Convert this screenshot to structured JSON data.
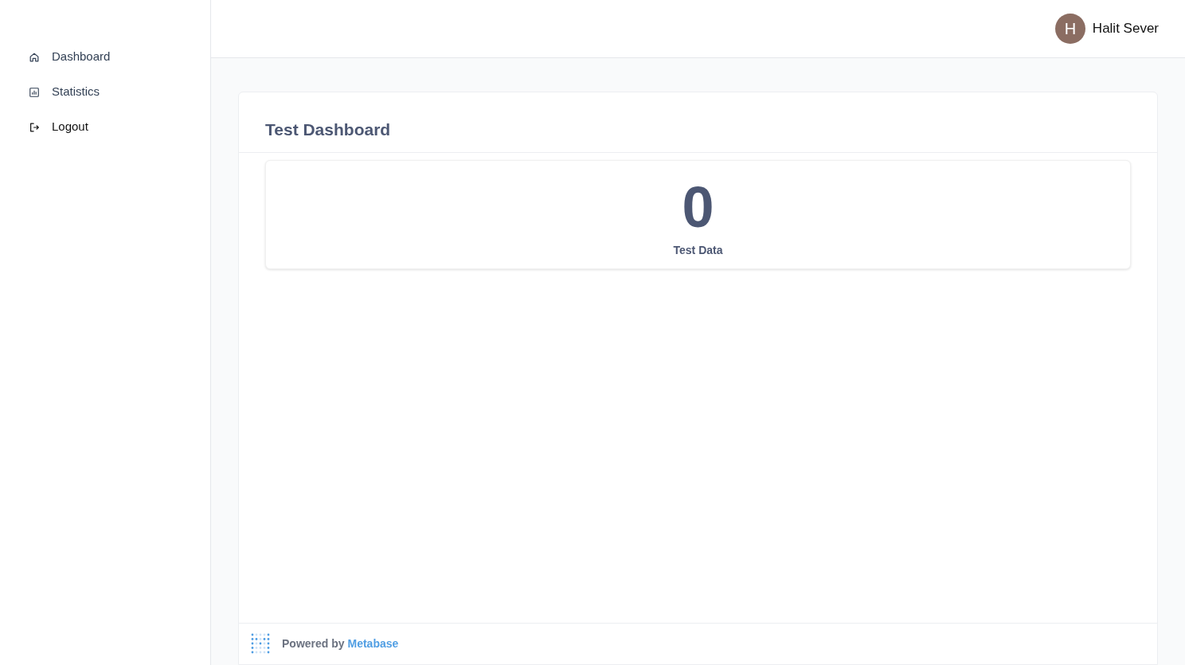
{
  "sidebar": {
    "items": [
      {
        "label": "Dashboard",
        "kind": "nav"
      },
      {
        "label": "Statistics",
        "kind": "nav"
      },
      {
        "label": "Logout",
        "kind": "action"
      }
    ]
  },
  "header": {
    "user": {
      "initial": "H",
      "name": "Halit Sever"
    }
  },
  "dashboard": {
    "title": "Test Dashboard",
    "metric": {
      "value": "0",
      "label": "Test Data"
    },
    "footer": {
      "prefix": "Powered by",
      "link": "Metabase"
    }
  }
}
